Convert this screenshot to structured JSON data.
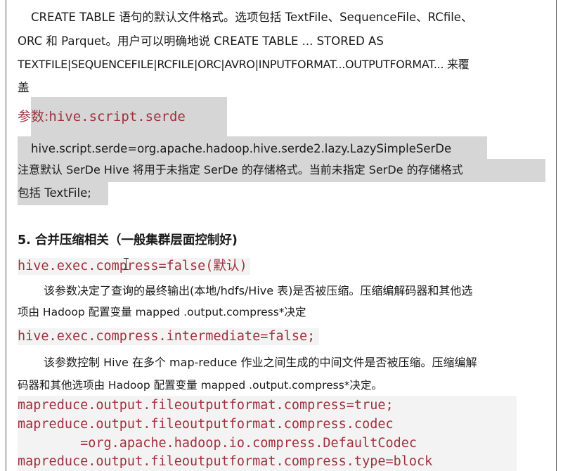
{
  "doc": {
    "intro": {
      "line1": "CREATE TABLE 语句的默认文件格式。选项包括 TextFile、SequenceFile、RCfile、",
      "line2": "ORC 和 Parquet。用户可以明确地说 CREATE TABLE ... STORED AS",
      "line3": "TEXTFILE|SEQUENCEFILE|RCFILE|ORC|AVRO|INPUTFORMAT...OUTPUTFORMAT... 来覆",
      "line4": "盖"
    },
    "param_label": "参数:",
    "param_name": "hive.script.serde",
    "serde_value": "hive.script.serde=org.apache.hadoop.hive.serde2.lazy.LazySimpleSerDe",
    "serde_note_line1": "注意默认 SerDe Hive 将用于未指定 SerDe 的存储格式。当前未指定 SerDe 的存储格式",
    "serde_note_line2": "包括 TextFile;",
    "section_heading": "5.  合并压缩相关（一般集群层面控制好)",
    "compress_code": "hive.exec.compress=false(默认)",
    "compress_desc_line1": "该参数决定了查询的最终输出(本地/hdfs/Hive 表)是否被压缩。压缩编解码器和其他选",
    "compress_desc_line2": "项由 Hadoop 配置变量 mapped .output.compress*决定",
    "intermediate_code": "hive.exec.compress.intermediate=false;",
    "intermediate_desc_line1": "该参数控制 Hive 在多个 map-reduce 作业之间生成的中间文件是否被压缩。压缩编解",
    "intermediate_desc_line2": "码器和其他选项由 Hadoop 配置变量 mapped .output.compress*决定。",
    "mr_code": {
      "line1": "mapreduce.output.fileoutputformat.compress=true;",
      "line2": "mapreduce.output.fileoutputformat.compress.codec",
      "line3": "        =org.apache.hadoop.io.compress.DefaultCodec",
      "line4": "mapreduce.output.fileoutputformat.compress.type=block"
    }
  }
}
